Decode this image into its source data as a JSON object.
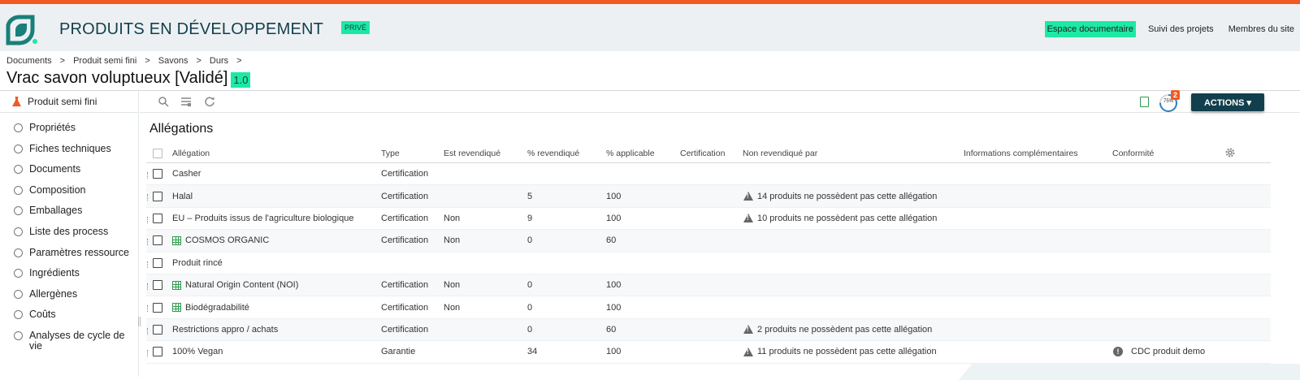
{
  "header": {
    "app_title": "PRODUITS EN DÉVELOPPEMENT",
    "badge": "PRIVÉ",
    "nav": [
      {
        "label": "Espace documentaire",
        "active": true
      },
      {
        "label": "Suivi des projets",
        "active": false
      },
      {
        "label": "Membres du site",
        "active": false
      }
    ]
  },
  "breadcrumb": [
    "Documents",
    ">",
    "Produit semi fini",
    ">",
    "Savons",
    ">",
    "Durs",
    ">"
  ],
  "document": {
    "title": "Vrac savon voluptueux [Validé]",
    "version": "1.0"
  },
  "sidebar": {
    "header": "Produit semi fini",
    "items": [
      "Propriétés",
      "Fiches techniques",
      "Documents",
      "Composition",
      "Emballages",
      "Liste des process",
      "Paramètres ressource",
      "Ingrédients",
      "Allergènes",
      "Coûts",
      "Analyses de cycle de vie"
    ]
  },
  "toolbar": {
    "actions_label": "ACTIONS ▾",
    "progress_label": "75%",
    "progress_value": 0.75,
    "notification_count": "2"
  },
  "section": {
    "title": "Allégations",
    "columns": {
      "allegation": "Allégation",
      "type": "Type",
      "claimed": "Est revendiqué",
      "pct_claimed": "% revendiqué",
      "pct_applicable": "% applicable",
      "certification": "Certification",
      "not_claimed_by": "Non revendiqué par",
      "info": "Informations complémentaires",
      "compliance": "Conformité"
    },
    "rows": [
      {
        "name": "Casher",
        "grid": false,
        "type": "Certification",
        "claimed": "",
        "pct_claimed": "",
        "pct_applicable": "",
        "warning": "",
        "compliance": ""
      },
      {
        "name": "Halal",
        "grid": false,
        "type": "Certification",
        "claimed": "",
        "pct_claimed": "5",
        "pct_applicable": "100",
        "warning": "14 produits ne possèdent pas cette allégation",
        "compliance": ""
      },
      {
        "name": "EU – Produits issus de l'agriculture biologique",
        "grid": false,
        "type": "Certification",
        "claimed": "Non",
        "pct_claimed": "9",
        "pct_applicable": "100",
        "warning": "10 produits ne possèdent pas cette allégation",
        "compliance": ""
      },
      {
        "name": "COSMOS ORGANIC",
        "grid": true,
        "type": "Certification",
        "claimed": "Non",
        "pct_claimed": "0",
        "pct_applicable": "60",
        "warning": "",
        "compliance": ""
      },
      {
        "name": "Produit rincé",
        "grid": false,
        "type": "",
        "claimed": "",
        "pct_claimed": "",
        "pct_applicable": "",
        "warning": "",
        "compliance": ""
      },
      {
        "name": "Natural Origin Content (NOI)",
        "grid": true,
        "type": "Certification",
        "claimed": "Non",
        "pct_claimed": "0",
        "pct_applicable": "100",
        "warning": "",
        "compliance": ""
      },
      {
        "name": "Biodégradabilité",
        "grid": true,
        "type": "Certification",
        "claimed": "Non",
        "pct_claimed": "0",
        "pct_applicable": "100",
        "warning": "",
        "compliance": ""
      },
      {
        "name": "Restrictions appro / achats",
        "grid": false,
        "type": "Certification",
        "claimed": "",
        "pct_claimed": "0",
        "pct_applicable": "60",
        "warning": "2 produits ne possèdent pas cette allégation",
        "compliance": ""
      },
      {
        "name": "100% Vegan",
        "grid": false,
        "type": "Garantie",
        "claimed": "",
        "pct_claimed": "34",
        "pct_applicable": "100",
        "warning": "11 produits ne possèdent pas cette allégation",
        "compliance": "CDC produit demo"
      }
    ]
  },
  "colors": {
    "accent": "#f15a24",
    "highlight": "#1de9a5",
    "brand": "#123f4d"
  }
}
